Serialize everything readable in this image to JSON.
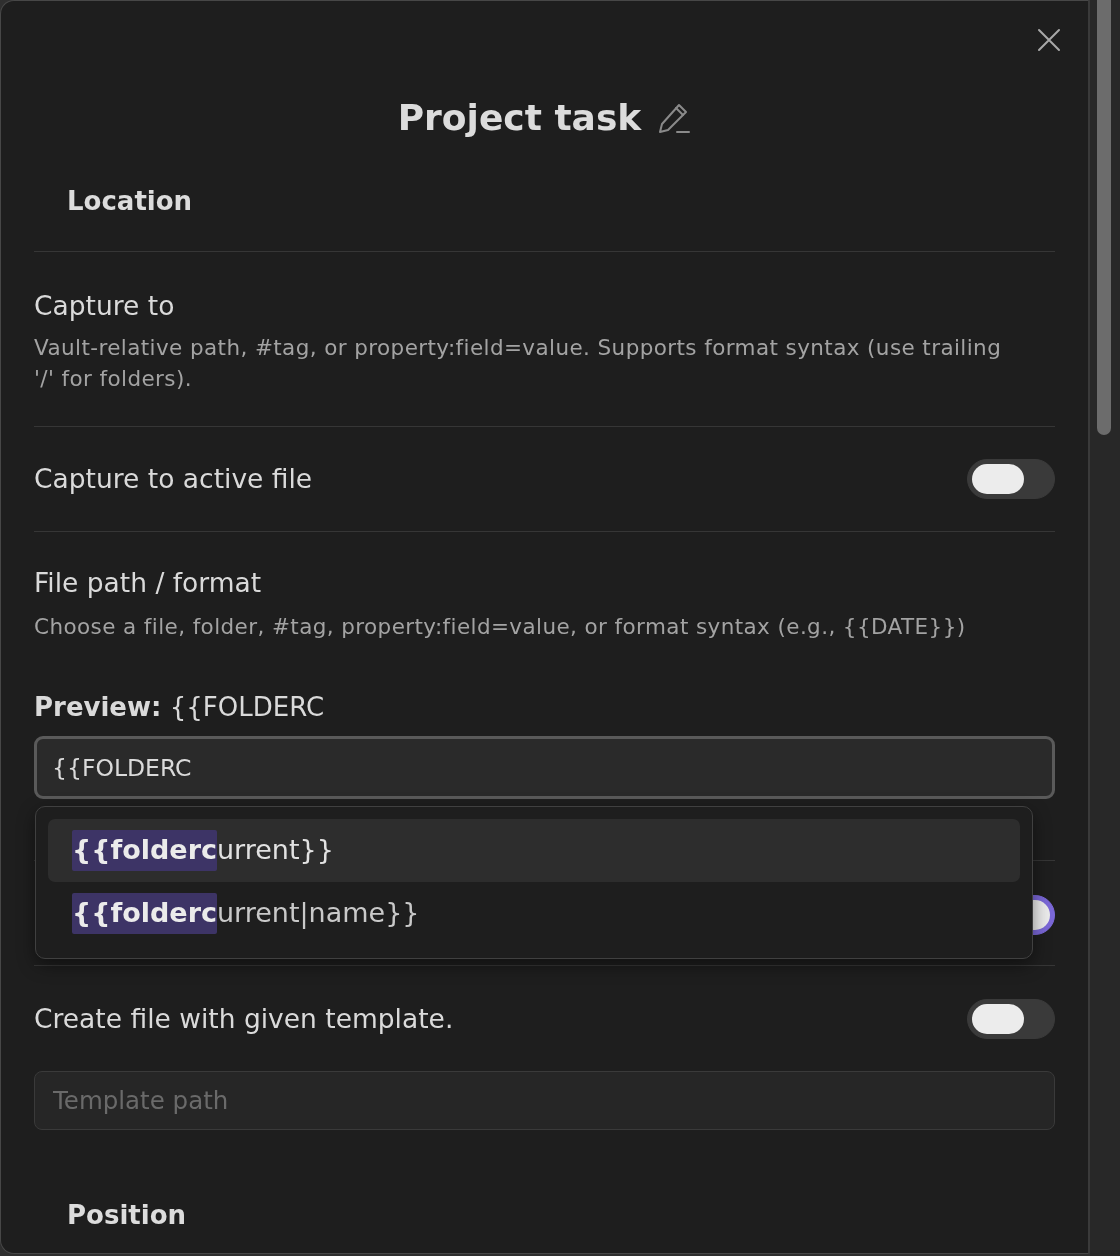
{
  "dialog": {
    "title": "Project task"
  },
  "location_heading": "Location",
  "settings": [
    {
      "kind": "text",
      "name": "Capture to",
      "description": "Vault-relative path, #tag, or property:field=value. Supports format syntax (use trailing '/' for folders)."
    },
    {
      "kind": "toggle",
      "name": "Capture to active file",
      "on": false
    },
    {
      "kind": "path",
      "name": "File path / format",
      "description": "Choose a file, folder, #tag, property:field=value, or format syntax (e.g., {{DATE}})",
      "preview": "**Preview:** {{FOLDERC",
      "value": "{{FOLDERC",
      "suggestions": [
        {
          "text": "**{{folderc**urrent}}",
          "selected": true
        },
        {
          "text": "**{{folderc**urrent|name}}",
          "selected": false
        }
      ]
    },
    {
      "kind": "toggle",
      "on": true
    },
    {
      "kind": "toggle",
      "name": "Create file with given template.",
      "on": false,
      "template": {
        "placeholder": "Template path"
      }
    }
  ],
  "position_heading": "Position"
}
